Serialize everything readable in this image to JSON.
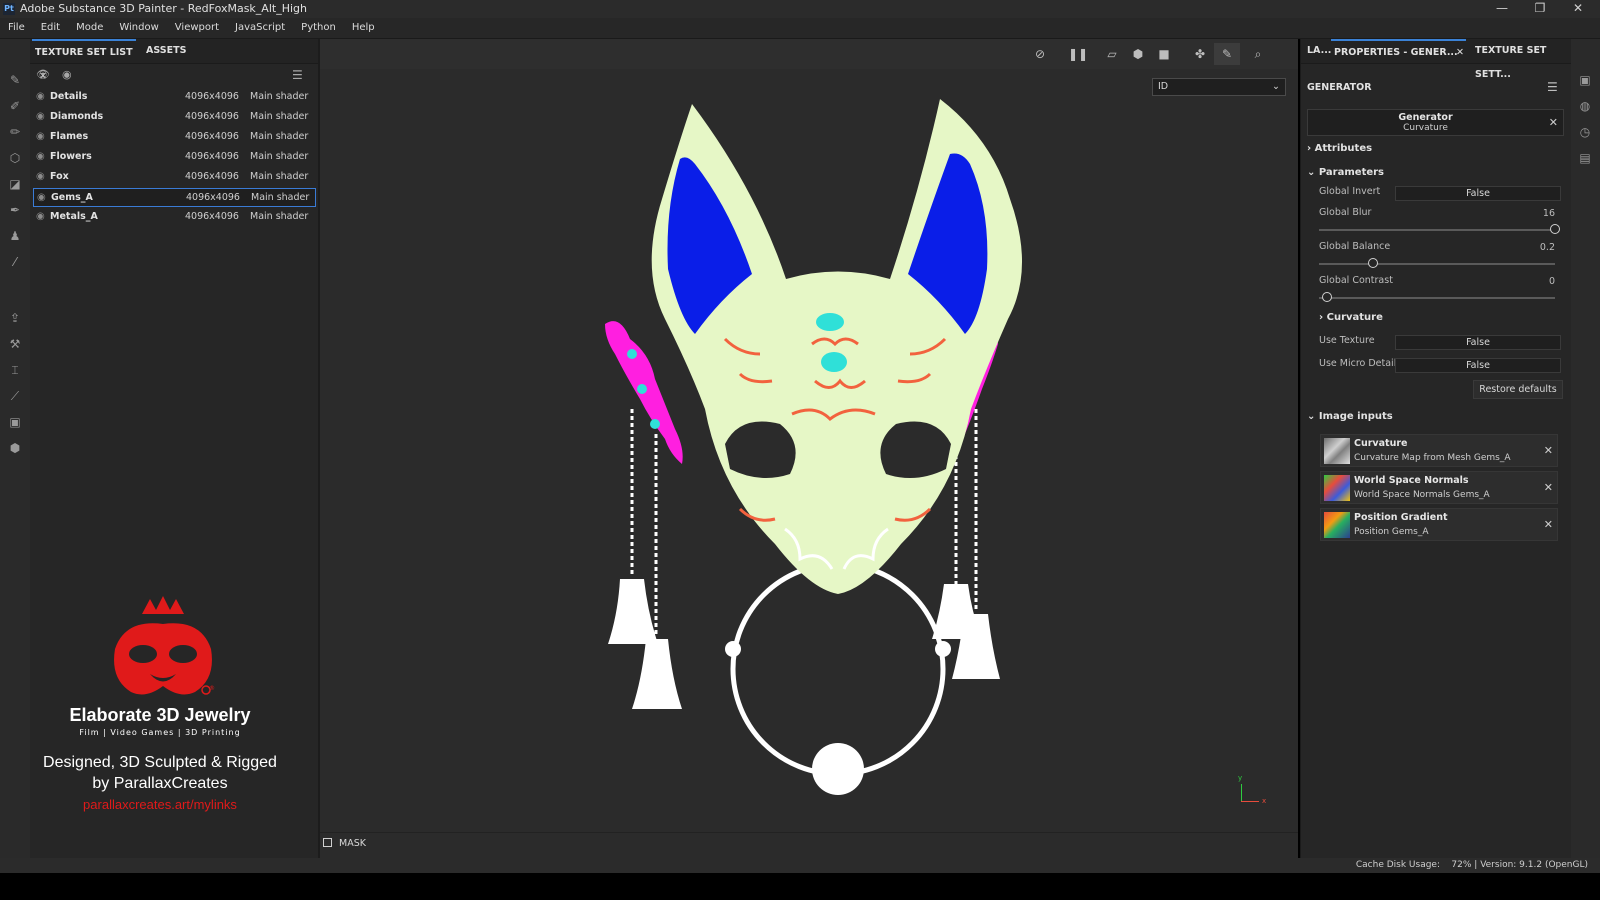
{
  "app": {
    "title": "Adobe Substance 3D Painter - RedFoxMask_Alt_High",
    "logo_text": "Pt",
    "minimize": "—",
    "restore": "❐",
    "close": "✕"
  },
  "menu": [
    "File",
    "Edit",
    "Mode",
    "Window",
    "Viewport",
    "JavaScript",
    "Python",
    "Help"
  ],
  "left_panel": {
    "tabs": [
      {
        "label": "TEXTURE SET LIST",
        "active": true,
        "close": "✕"
      },
      {
        "label": "ASSETS",
        "active": false
      }
    ],
    "texture_sets": [
      {
        "name": "Details",
        "resolution": "4096x4096",
        "shader": "Main shader",
        "selected": false
      },
      {
        "name": "Diamonds",
        "resolution": "4096x4096",
        "shader": "Main shader",
        "selected": false
      },
      {
        "name": "Flames",
        "resolution": "4096x4096",
        "shader": "Main shader",
        "selected": false
      },
      {
        "name": "Flowers",
        "resolution": "4096x4096",
        "shader": "Main shader",
        "selected": false
      },
      {
        "name": "Fox",
        "resolution": "4096x4096",
        "shader": "Main shader",
        "selected": false
      },
      {
        "name": "Gems_A",
        "resolution": "4096x4096",
        "shader": "Main shader",
        "selected": true
      },
      {
        "name": "Metals_A",
        "resolution": "4096x4096",
        "shader": "Main shader",
        "selected": false
      }
    ]
  },
  "promo": {
    "headline": "Elaborate 3D Jewelry",
    "subline": "Film | Video Games | 3D Printing",
    "line1": "Designed, 3D Sculpted & Rigged",
    "line2": "by ParallaxCreates",
    "link": "parallaxcreates.art/mylinks",
    "registered": "®"
  },
  "viewport": {
    "channel_select": "ID",
    "mask_label": "MASK",
    "axis_y": "y",
    "axis_x": "x",
    "colors": {
      "mask_face": "#e6f7c6",
      "ear_inner": "#0a1ee8",
      "gem": "#2fe0d8",
      "accent": "#f2623e",
      "magenta": "#ff1fe0",
      "white": "#ffffff"
    }
  },
  "right_panel": {
    "tabs": [
      {
        "label": "LA...",
        "active": false
      },
      {
        "label": "PROPERTIES - GENER...",
        "active": true,
        "close": "✕"
      },
      {
        "label": "TEXTURE SET SETT...",
        "active": false
      }
    ],
    "section_title": "GENERATOR",
    "generator_card": {
      "title": "Generator",
      "subtitle": "Curvature",
      "close": "✕"
    },
    "attributes_label": "Attributes",
    "parameters_label": "Parameters",
    "params": {
      "global_invert": {
        "label": "Global Invert",
        "value": "False"
      },
      "global_blur": {
        "label": "Global Blur",
        "value": "16",
        "fraction": 1.0
      },
      "global_balance": {
        "label": "Global Balance",
        "value": "0.2",
        "fraction": 0.2
      },
      "global_contrast": {
        "label": "Global Contrast",
        "value": "0",
        "fraction": 0.0
      }
    },
    "curvature_label": "Curvature",
    "use_texture": {
      "label": "Use Texture",
      "value": "False"
    },
    "use_micro_details": {
      "label": "Use Micro Details",
      "value": "False"
    },
    "restore_defaults": "Restore defaults",
    "image_inputs_label": "Image inputs",
    "image_inputs": [
      {
        "title": "Curvature",
        "subtitle": "Curvature Map from Mesh Gems_A"
      },
      {
        "title": "World Space Normals",
        "subtitle": "World Space Normals Gems_A"
      },
      {
        "title": "Position Gradient",
        "subtitle": "Position Gems_A"
      }
    ]
  },
  "status": {
    "text": "Cache Disk Usage:    72% | Version: 9.1.2 (OpenGL)"
  }
}
